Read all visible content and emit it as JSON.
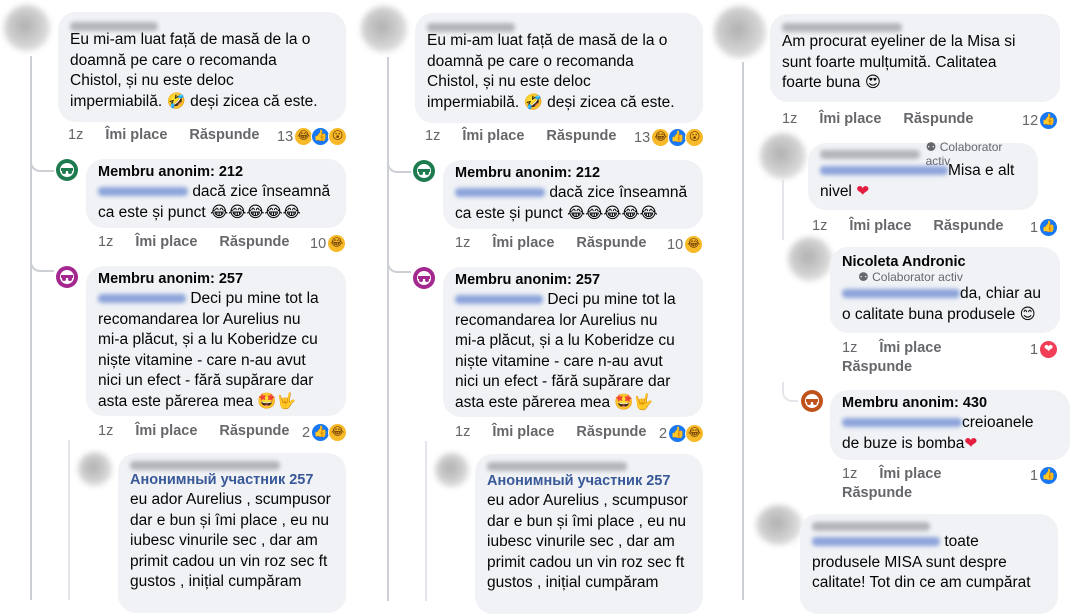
{
  "reactions": {
    "like": "👍",
    "haha": "😂",
    "wow": "😮",
    "love": "❤"
  },
  "col1": {
    "c1": {
      "text1": "Eu mi-am luat față de masă de la o",
      "text2": "doamnă pe care o recomanda",
      "text3": "Chistol, și nu este deloc",
      "text4": "impermiabilă. 🤣 deși zicea că este.",
      "age": "1z",
      "like": "Îmi place",
      "reply": "Răspunde",
      "count": "13"
    },
    "r1": {
      "author": "Membru anonim: 212",
      "text1": "dacă zice înseamnă",
      "text2": "ca este și punct 😂😂😂😂😂",
      "age": "1z",
      "like": "Îmi place",
      "reply": "Răspunde",
      "count": "10"
    },
    "r2": {
      "author": "Membru anonim: 257",
      "text1": "Deci pu mine tot la",
      "text2": "recomandarea lor Aurelius nu",
      "text3": "mi-a plăcut, și a lu Koberidze cu",
      "text4": "niște vitamine - care n-au avut",
      "text5": "nici un efect - fără supărare dar",
      "text6": "asta este părerea mea 🤩🤟",
      "age": "1z",
      "like": "Îmi place",
      "reply": "Răspunde",
      "count": "2"
    },
    "r3": {
      "tag": "Анонимный участник 257",
      "text1": "eu ador Aurelius , scumpusor",
      "text2": "dar e bun și îmi place , eu nu",
      "text3": "iubesc vinurile sec , dar am",
      "text4": "primit cadou un vin roz sec ft",
      "text5": "gustos , inițial cumpăram"
    }
  },
  "col3": {
    "c1": {
      "text1": "Am procurat eyeliner de la Misa si",
      "text2": "sunt foarte mulțumită. Calitatea",
      "text3": "foarte buna 😍",
      "age": "1z",
      "like": "Îmi place",
      "reply": "Răspunde",
      "count": "12"
    },
    "r1": {
      "badge": "Colaborator activ",
      "text1": "Misa e alt",
      "text2": "nivel",
      "age": "1z",
      "like": "Îmi place",
      "reply": "Răspunde",
      "count": "1"
    },
    "r2": {
      "author": "Nicoleta Andronic",
      "badge": "Colaborator activ",
      "text1": "da, chiar au",
      "text2": "o calitate buna produsele 😊",
      "age": "1z",
      "like": "Îmi place",
      "reply": "Răspunde",
      "count": "1"
    },
    "r3": {
      "author": "Membru anonim: 430",
      "text1": "creioanele",
      "text2": "de buze is bomba",
      "age": "1z",
      "like": "Îmi place",
      "reply": "Răspunde",
      "count": "1"
    },
    "r4": {
      "text1": "toate",
      "text2": "produsele MISA sunt despre",
      "text3": "calitate! Tot din ce am cumpărat"
    }
  }
}
